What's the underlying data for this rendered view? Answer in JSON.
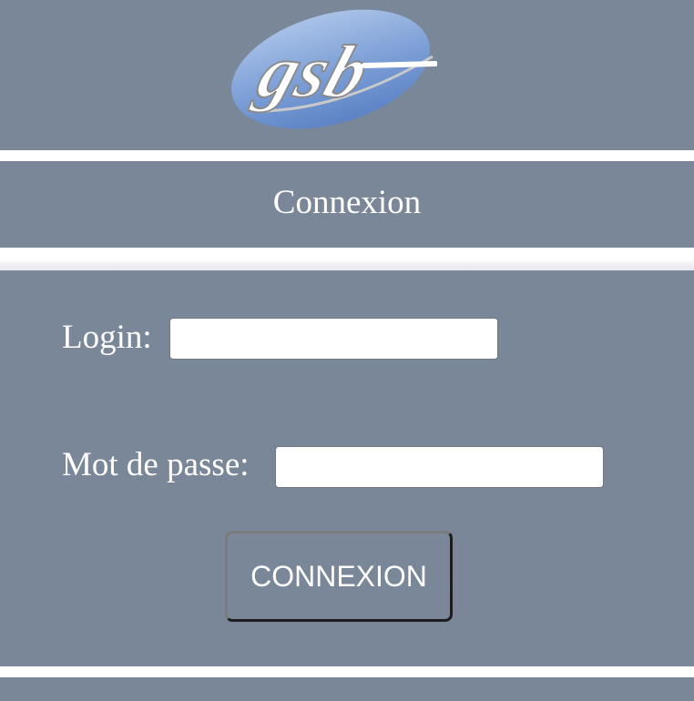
{
  "header": {
    "logo_text": "gsb"
  },
  "page": {
    "title": "Connexion"
  },
  "form": {
    "login_label": "Login:",
    "login_value": "",
    "password_label": "Mot de passe:",
    "password_value": "",
    "submit_label": "CONNEXION"
  },
  "colors": {
    "band": "#7a8798",
    "logo_blue": "#6f95d0",
    "text": "#ffffff"
  }
}
